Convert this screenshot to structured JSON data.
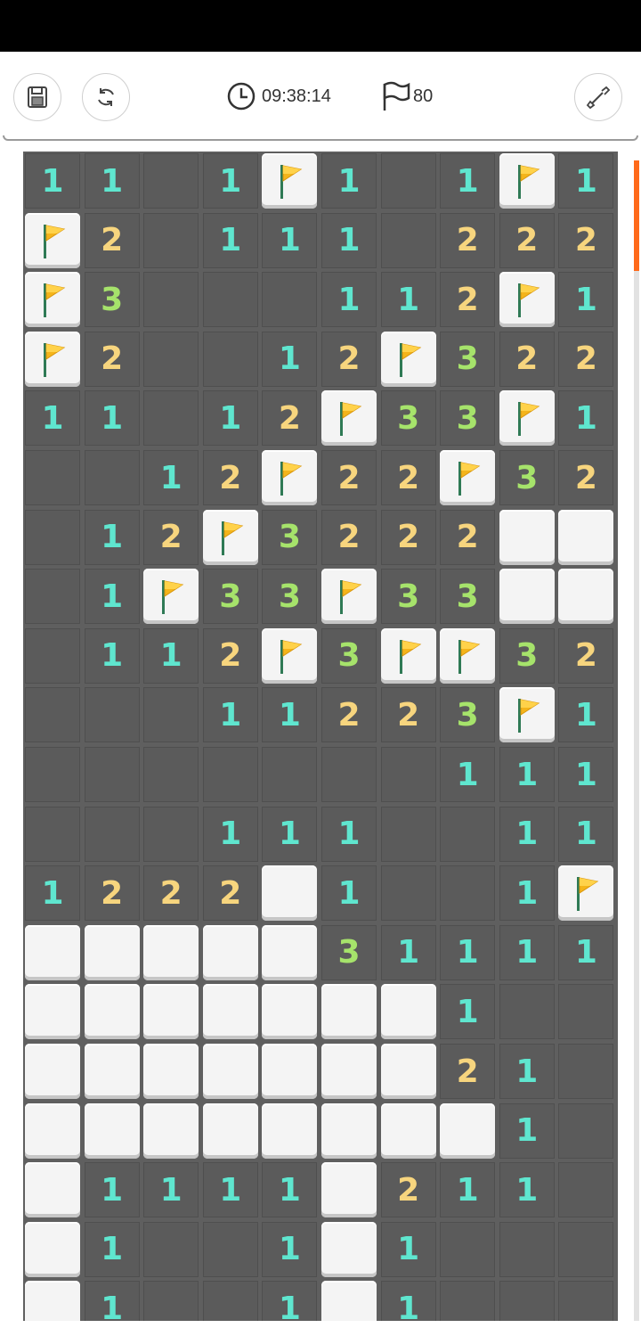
{
  "toolbar": {
    "save_icon": "save-icon",
    "restart_icon": "refresh-icon",
    "timer_icon": "clock-icon",
    "timer_value": "09:38:14",
    "flags_icon": "flag-outline-icon",
    "flags_count": "80",
    "dig_icon": "shovel-icon"
  },
  "colors": {
    "one": "#5fe6cf",
    "two": "#f7d57e",
    "three": "#a6e36b",
    "scrollbar": "#ff6a1a"
  },
  "board": {
    "rows": [
      [
        "1",
        "1",
        "0",
        "1",
        "F",
        "1",
        "0",
        "1",
        "F",
        "1"
      ],
      [
        "F",
        "2",
        "0",
        "1",
        "1",
        "1",
        "0",
        "2",
        "2",
        "2"
      ],
      [
        "F",
        "3",
        "0",
        "0",
        "0",
        "1",
        "1",
        "2",
        "F",
        "1"
      ],
      [
        "F",
        "2",
        "0",
        "0",
        "1",
        "2",
        "F",
        "3",
        "2",
        "2"
      ],
      [
        "1",
        "1",
        "0",
        "1",
        "2",
        "F",
        "3",
        "3",
        "F",
        "1"
      ],
      [
        "0",
        "0",
        "1",
        "2",
        "F",
        "2",
        "2",
        "F",
        "3",
        "2"
      ],
      [
        "0",
        "1",
        "2",
        "F",
        "3",
        "2",
        "2",
        "2",
        "H",
        "H"
      ],
      [
        "0",
        "1",
        "F",
        "3",
        "3",
        "F",
        "3",
        "3",
        "H",
        "H"
      ],
      [
        "0",
        "1",
        "1",
        "2",
        "F",
        "3",
        "F",
        "F",
        "3",
        "2"
      ],
      [
        "0",
        "0",
        "0",
        "1",
        "1",
        "2",
        "2",
        "3",
        "F",
        "1"
      ],
      [
        "0",
        "0",
        "0",
        "0",
        "0",
        "0",
        "0",
        "1",
        "1",
        "1"
      ],
      [
        "0",
        "0",
        "0",
        "1",
        "1",
        "1",
        "0",
        "0",
        "1",
        "1"
      ],
      [
        "1",
        "2",
        "2",
        "2",
        "H",
        "1",
        "0",
        "0",
        "1",
        "F"
      ],
      [
        "H",
        "H",
        "H",
        "H",
        "H",
        "3",
        "1",
        "1",
        "1",
        "1"
      ],
      [
        "H",
        "H",
        "H",
        "H",
        "H",
        "H",
        "H",
        "1",
        "0",
        "0"
      ],
      [
        "H",
        "H",
        "H",
        "H",
        "H",
        "H",
        "H",
        "2",
        "1",
        "0"
      ],
      [
        "H",
        "H",
        "H",
        "H",
        "H",
        "H",
        "H",
        "H",
        "1",
        "0"
      ],
      [
        "H",
        "1",
        "1",
        "1",
        "1",
        "H",
        "2",
        "1",
        "1",
        "0"
      ],
      [
        "H",
        "1",
        "0",
        "0",
        "1",
        "H",
        "1",
        "0",
        "0",
        "0"
      ],
      [
        "H",
        "1",
        "0",
        "0",
        "1",
        "H",
        "1",
        "0",
        "0",
        "0"
      ]
    ]
  }
}
